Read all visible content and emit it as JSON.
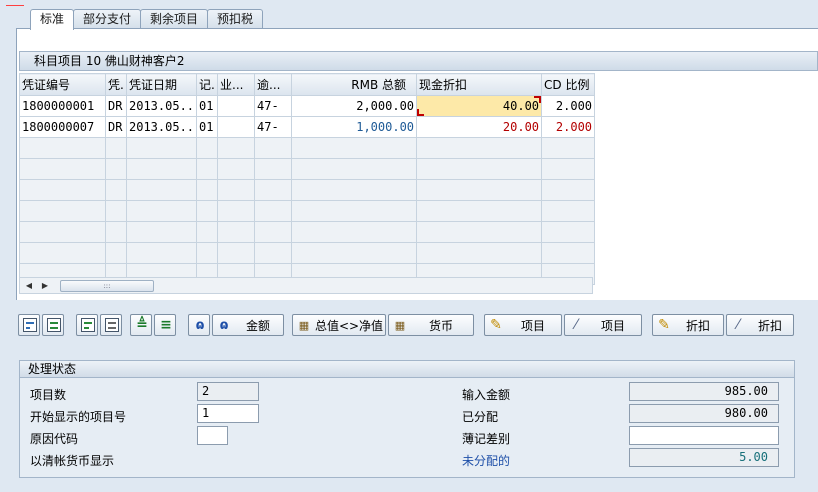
{
  "tabs": [
    "标准",
    "部分支付",
    "剩余项目",
    "预扣税"
  ],
  "group_title": "科目项目 10 佛山财神客户2",
  "columns": [
    "凭证编号",
    "凭.",
    "凭证日期",
    "记.",
    "业...",
    "逾...",
    "RMB 总额",
    "现金折扣",
    "CD 比例"
  ],
  "rows": [
    [
      "1800000001",
      "DR",
      "2013.05..",
      "01",
      "",
      "47-",
      "2,000.00",
      "40.00",
      "2.000"
    ],
    [
      "1800000007",
      "DR",
      "2013.05..",
      "01",
      "",
      "47-",
      "1,000.00",
      "20.00",
      "2.000"
    ]
  ],
  "toolbar": {
    "amount": "金额",
    "gross_net": "总值<>净值",
    "currency": "货币",
    "item1": "项目",
    "item2": "项目",
    "discount1": "折扣",
    "discount2": "折扣"
  },
  "status": {
    "title": "处理状态",
    "item_count_label": "项目数",
    "item_count": "2",
    "start_item_label": "开始显示的项目号",
    "start_item": "1",
    "reason_code_label": "原因代码",
    "reason_code": "",
    "clearing_currency_label": "以清帐货币显示",
    "entered_amount_label": "输入金额",
    "entered_amount": "985.00",
    "assigned_label": "已分配",
    "assigned": "980.00",
    "posting_diff_label": "薄记差别",
    "posting_diff": "",
    "not_assigned_label": "未分配的",
    "not_assigned": "5.00"
  },
  "colors": {
    "background": "#dfe8f2",
    "selected_cell": "#fde9a8",
    "blue_value": "#1e5a96",
    "red_value": "#b30000"
  }
}
